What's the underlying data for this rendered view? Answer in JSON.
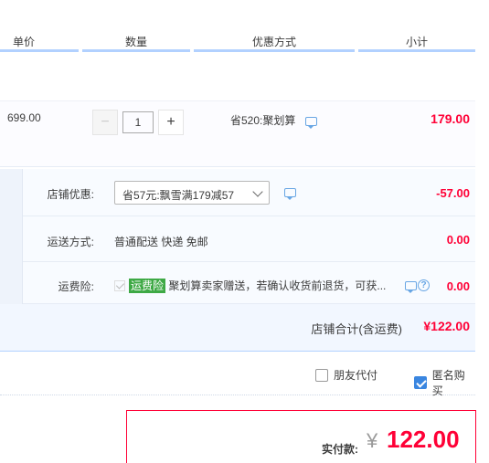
{
  "header": {
    "unit_price": "单价",
    "quantity": "数量",
    "promotion": "优惠方式",
    "subtotal": "小计"
  },
  "item": {
    "price": "699.00",
    "quantity": "1",
    "minus": "−",
    "plus": "+",
    "promotion": "省520:聚划算",
    "subtotal": "179.00"
  },
  "shop": {
    "discount_label": "店铺优惠:",
    "discount_select": "省57元:飘雪满179减57",
    "discount_amount": "-57.00",
    "shipping_label": "运送方式:",
    "shipping_value": "普通配送 快递 免邮",
    "shipping_amount": "0.00",
    "insurance_label": "运费险:",
    "insurance_tag": "运费险",
    "insurance_text": "聚划算卖家赠送，若确认收货前退货，可获...",
    "insurance_amount": "0.00",
    "total_label": "店铺合计(含运费)",
    "total_value": "¥122.00"
  },
  "options": {
    "friend_pay": "朋友代付",
    "anonymous": "匿名购买"
  },
  "payment": {
    "label": "实付款:",
    "currency": "¥",
    "amount": "122.00"
  },
  "colors": {
    "accent_red": "#ff0036",
    "accent_blue": "#b2d1ff",
    "tag_green": "#3ea945"
  }
}
